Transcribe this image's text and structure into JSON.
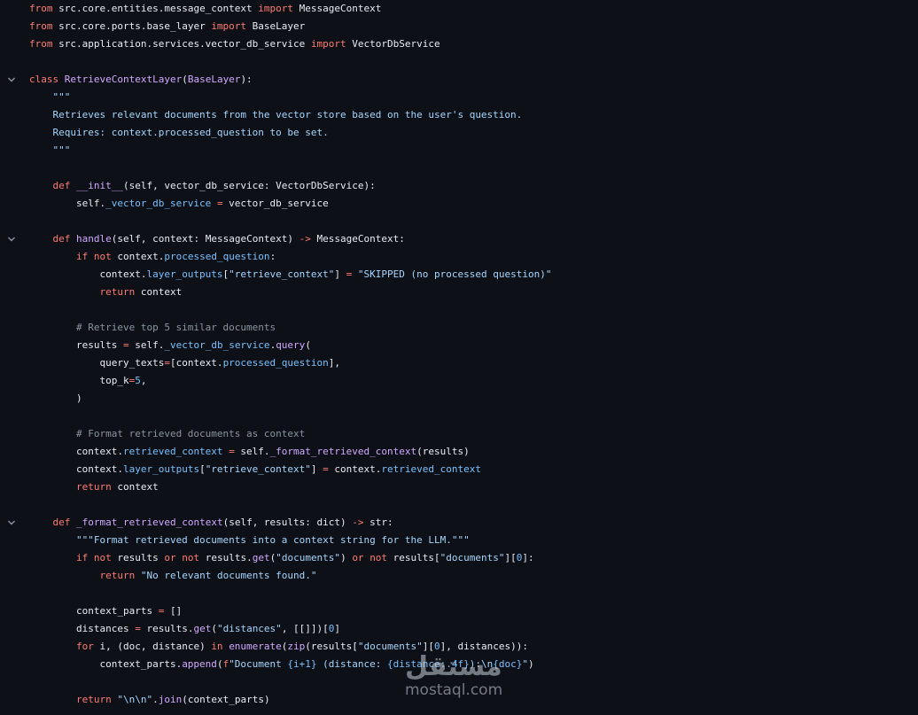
{
  "code": {
    "lines": [
      {
        "n": 1,
        "fold": false,
        "tokens": [
          [
            "k",
            "from"
          ],
          [
            "o",
            " src.core.entities.message_context "
          ],
          [
            "k",
            "import"
          ],
          [
            "o",
            " MessageContext"
          ]
        ]
      },
      {
        "n": 2,
        "fold": false,
        "tokens": [
          [
            "k",
            "from"
          ],
          [
            "o",
            " src.core.ports.base_layer "
          ],
          [
            "k",
            "import"
          ],
          [
            "o",
            " BaseLayer"
          ]
        ]
      },
      {
        "n": 3,
        "fold": false,
        "tokens": [
          [
            "k",
            "from"
          ],
          [
            "o",
            " src.application.services.vector_db_service "
          ],
          [
            "k",
            "import"
          ],
          [
            "o",
            " VectorDbService"
          ]
        ]
      },
      {
        "n": 4,
        "fold": false,
        "tokens": []
      },
      {
        "n": 5,
        "fold": true,
        "tokens": [
          [
            "k",
            "class"
          ],
          [
            "o",
            " "
          ],
          [
            "f",
            "RetrieveContextLayer"
          ],
          [
            "o",
            "("
          ],
          [
            "f",
            "BaseLayer"
          ],
          [
            "o",
            "):"
          ]
        ]
      },
      {
        "n": 6,
        "fold": false,
        "tokens": [
          [
            "s",
            "    \"\"\""
          ]
        ]
      },
      {
        "n": 7,
        "fold": false,
        "tokens": [
          [
            "s",
            "    Retrieves relevant documents from the vector store based on the user's question."
          ]
        ]
      },
      {
        "n": 8,
        "fold": false,
        "tokens": [
          [
            "s",
            "    Requires: context.processed_question to be set."
          ]
        ]
      },
      {
        "n": 9,
        "fold": false,
        "tokens": [
          [
            "s",
            "    \"\"\""
          ]
        ]
      },
      {
        "n": 10,
        "fold": false,
        "tokens": []
      },
      {
        "n": 11,
        "fold": false,
        "tokens": [
          [
            "o",
            "    "
          ],
          [
            "k",
            "def"
          ],
          [
            "o",
            " "
          ],
          [
            "f",
            "__init__"
          ],
          [
            "o",
            "(self, vector_db_service: VectorDbService):"
          ]
        ]
      },
      {
        "n": 12,
        "fold": false,
        "tokens": [
          [
            "o",
            "        self."
          ],
          [
            "n",
            "_vector_db_service"
          ],
          [
            "o",
            " "
          ],
          [
            "k",
            "="
          ],
          [
            "o",
            " vector_db_service"
          ]
        ]
      },
      {
        "n": 13,
        "fold": false,
        "tokens": []
      },
      {
        "n": 14,
        "fold": true,
        "tokens": [
          [
            "o",
            "    "
          ],
          [
            "k",
            "def"
          ],
          [
            "o",
            " "
          ],
          [
            "f",
            "handle"
          ],
          [
            "o",
            "(self, context: MessageContext) "
          ],
          [
            "k",
            "->"
          ],
          [
            "o",
            " MessageContext:"
          ]
        ]
      },
      {
        "n": 15,
        "fold": false,
        "tokens": [
          [
            "o",
            "        "
          ],
          [
            "k",
            "if"
          ],
          [
            "o",
            " "
          ],
          [
            "k",
            "not"
          ],
          [
            "o",
            " context."
          ],
          [
            "n",
            "processed_question"
          ],
          [
            "o",
            ":"
          ]
        ]
      },
      {
        "n": 16,
        "fold": false,
        "tokens": [
          [
            "o",
            "            context."
          ],
          [
            "n",
            "layer_outputs"
          ],
          [
            "o",
            "["
          ],
          [
            "s",
            "\"retrieve_context\""
          ],
          [
            "o",
            "] "
          ],
          [
            "k",
            "="
          ],
          [
            "o",
            " "
          ],
          [
            "s",
            "\"SKIPPED (no processed question)\""
          ]
        ]
      },
      {
        "n": 17,
        "fold": false,
        "tokens": [
          [
            "o",
            "            "
          ],
          [
            "k",
            "return"
          ],
          [
            "o",
            " context"
          ]
        ]
      },
      {
        "n": 18,
        "fold": false,
        "tokens": []
      },
      {
        "n": 19,
        "fold": false,
        "tokens": [
          [
            "c",
            "        # Retrieve top 5 similar documents"
          ]
        ]
      },
      {
        "n": 20,
        "fold": false,
        "tokens": [
          [
            "o",
            "        results "
          ],
          [
            "k",
            "="
          ],
          [
            "o",
            " self."
          ],
          [
            "n",
            "_vector_db_service"
          ],
          [
            "o",
            "."
          ],
          [
            "f",
            "query"
          ],
          [
            "o",
            "("
          ]
        ]
      },
      {
        "n": 21,
        "fold": false,
        "tokens": [
          [
            "o",
            "            query_texts"
          ],
          [
            "k",
            "="
          ],
          [
            "o",
            "[context."
          ],
          [
            "n",
            "processed_question"
          ],
          [
            "o",
            "],"
          ]
        ]
      },
      {
        "n": 22,
        "fold": false,
        "tokens": [
          [
            "o",
            "            top_k"
          ],
          [
            "k",
            "="
          ],
          [
            "n",
            "5"
          ],
          [
            "o",
            ","
          ]
        ]
      },
      {
        "n": 23,
        "fold": false,
        "tokens": [
          [
            "o",
            "        )"
          ]
        ]
      },
      {
        "n": 24,
        "fold": false,
        "tokens": []
      },
      {
        "n": 25,
        "fold": false,
        "tokens": [
          [
            "c",
            "        # Format retrieved documents as context"
          ]
        ]
      },
      {
        "n": 26,
        "fold": false,
        "tokens": [
          [
            "o",
            "        context."
          ],
          [
            "n",
            "retrieved_context"
          ],
          [
            "o",
            " "
          ],
          [
            "k",
            "="
          ],
          [
            "o",
            " self."
          ],
          [
            "f",
            "_format_retrieved_context"
          ],
          [
            "o",
            "(results)"
          ]
        ]
      },
      {
        "n": 27,
        "fold": false,
        "tokens": [
          [
            "o",
            "        context."
          ],
          [
            "n",
            "layer_outputs"
          ],
          [
            "o",
            "["
          ],
          [
            "s",
            "\"retrieve_context\""
          ],
          [
            "o",
            "] "
          ],
          [
            "k",
            "="
          ],
          [
            "o",
            " context."
          ],
          [
            "n",
            "retrieved_context"
          ]
        ]
      },
      {
        "n": 28,
        "fold": false,
        "tokens": [
          [
            "o",
            "        "
          ],
          [
            "k",
            "return"
          ],
          [
            "o",
            " context"
          ]
        ]
      },
      {
        "n": 29,
        "fold": false,
        "tokens": []
      },
      {
        "n": 30,
        "fold": true,
        "tokens": [
          [
            "o",
            "    "
          ],
          [
            "k",
            "def"
          ],
          [
            "o",
            " "
          ],
          [
            "f",
            "_format_retrieved_context"
          ],
          [
            "o",
            "(self, results: dict) "
          ],
          [
            "k",
            "->"
          ],
          [
            "o",
            " str:"
          ]
        ]
      },
      {
        "n": 31,
        "fold": false,
        "tokens": [
          [
            "s",
            "        \"\"\"Format retrieved documents into a context string for the LLM.\"\"\""
          ]
        ]
      },
      {
        "n": 32,
        "fold": false,
        "tokens": [
          [
            "o",
            "        "
          ],
          [
            "k",
            "if"
          ],
          [
            "o",
            " "
          ],
          [
            "k",
            "not"
          ],
          [
            "o",
            " results "
          ],
          [
            "k",
            "or"
          ],
          [
            "o",
            " "
          ],
          [
            "k",
            "not"
          ],
          [
            "o",
            " results."
          ],
          [
            "f",
            "get"
          ],
          [
            "o",
            "("
          ],
          [
            "s",
            "\"documents\""
          ],
          [
            "o",
            ") "
          ],
          [
            "k",
            "or"
          ],
          [
            "o",
            " "
          ],
          [
            "k",
            "not"
          ],
          [
            "o",
            " results["
          ],
          [
            "s",
            "\"documents\""
          ],
          [
            "o",
            "]["
          ],
          [
            "n",
            "0"
          ],
          [
            "o",
            "]:"
          ]
        ]
      },
      {
        "n": 33,
        "fold": false,
        "tokens": [
          [
            "o",
            "            "
          ],
          [
            "k",
            "return"
          ],
          [
            "o",
            " "
          ],
          [
            "s",
            "\"No relevant documents found.\""
          ]
        ]
      },
      {
        "n": 34,
        "fold": false,
        "tokens": []
      },
      {
        "n": 35,
        "fold": false,
        "tokens": [
          [
            "o",
            "        context_parts "
          ],
          [
            "k",
            "="
          ],
          [
            "o",
            " []"
          ]
        ]
      },
      {
        "n": 36,
        "fold": false,
        "tokens": [
          [
            "o",
            "        distances "
          ],
          [
            "k",
            "="
          ],
          [
            "o",
            " results."
          ],
          [
            "f",
            "get"
          ],
          [
            "o",
            "("
          ],
          [
            "s",
            "\"distances\""
          ],
          [
            "o",
            ", [[]])["
          ],
          [
            "n",
            "0"
          ],
          [
            "o",
            "]"
          ]
        ]
      },
      {
        "n": 37,
        "fold": false,
        "tokens": [
          [
            "o",
            "        "
          ],
          [
            "k",
            "for"
          ],
          [
            "o",
            " i, (doc, distance) "
          ],
          [
            "k",
            "in"
          ],
          [
            "o",
            " "
          ],
          [
            "f",
            "enumerate"
          ],
          [
            "o",
            "("
          ],
          [
            "f",
            "zip"
          ],
          [
            "o",
            "(results["
          ],
          [
            "s",
            "\"documents\""
          ],
          [
            "o",
            "]["
          ],
          [
            "n",
            "0"
          ],
          [
            "o",
            "], distances)):"
          ]
        ]
      },
      {
        "n": 38,
        "fold": false,
        "tokens": [
          [
            "o",
            "            context_parts."
          ],
          [
            "f",
            "append"
          ],
          [
            "o",
            "("
          ],
          [
            "k",
            "f"
          ],
          [
            "s",
            "\"Document "
          ],
          [
            "n",
            "{i+1}"
          ],
          [
            "s",
            " (distance: "
          ],
          [
            "n",
            "{distance:.4f}"
          ],
          [
            "s",
            "):\\n"
          ],
          [
            "n",
            "{doc}"
          ],
          [
            "s",
            "\""
          ],
          [
            "o",
            ")"
          ]
        ]
      },
      {
        "n": 39,
        "fold": false,
        "tokens": []
      },
      {
        "n": 40,
        "fold": false,
        "tokens": [
          [
            "o",
            "        "
          ],
          [
            "k",
            "return"
          ],
          [
            "o",
            " "
          ],
          [
            "s",
            "\"\\n\\n\""
          ],
          [
            "o",
            "."
          ],
          [
            "f",
            "join"
          ],
          [
            "o",
            "(context_parts)"
          ]
        ]
      }
    ]
  },
  "watermark": {
    "logo": "مستقل",
    "text": "mostaql.com"
  },
  "colors": {
    "background": "#0d1117",
    "keyword": "#ff7b72",
    "function": "#d2a8ff",
    "string": "#a5d6ff",
    "comment": "#8b949e",
    "name": "#79c0ff",
    "text": "#e6edf3"
  },
  "icons": {
    "fold": "chevron-down-icon"
  }
}
